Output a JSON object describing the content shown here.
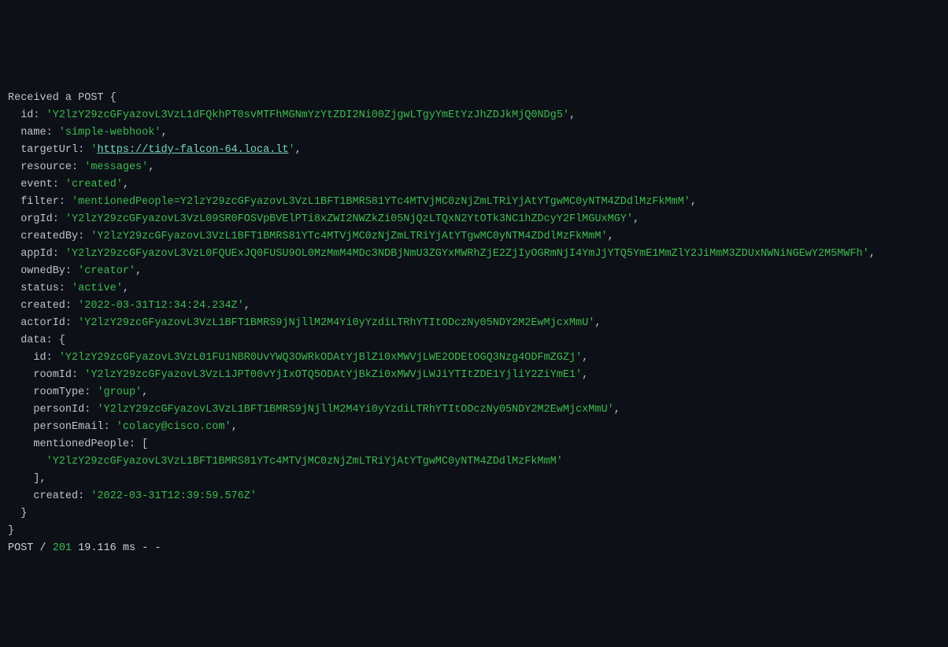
{
  "log": {
    "header": "Received a POST {",
    "id_key": "id:",
    "id_val": "'Y2lzY29zcGFyazovL3VzL1dFQkhPT0svMTFhMGNmYzYtZDI2Ni00ZjgwLTgyYmEtYzJhZDJkMjQ0NDg5'",
    "name_key": "name:",
    "name_val": "'simple-webhook'",
    "targetUrl_key": "targetUrl:",
    "targetUrl_q1": "'",
    "targetUrl_link": "https://tidy-falcon-64.loca.lt",
    "targetUrl_q2": "'",
    "resource_key": "resource:",
    "resource_val": "'messages'",
    "event_key": "event:",
    "event_val": "'created'",
    "filter_key": "filter:",
    "filter_val": "'mentionedPeople=Y2lzY29zcGFyazovL3VzL1BFT1BMRS81YTc4MTVjMC0zNjZmLTRiYjAtYTgwMC0yNTM4ZDdlMzFkMmM'",
    "orgId_key": "orgId:",
    "orgId_val": "'Y2lzY29zcGFyazovL3VzL09SR0FOSVpBVElPTi8xZWI2NWZkZi05NjQzLTQxN2YtOTk3NC1hZDcyY2FlMGUxMGY'",
    "createdBy_key": "createdBy:",
    "createdBy_val": "'Y2lzY29zcGFyazovL3VzL1BFT1BMRS81YTc4MTVjMC0zNjZmLTRiYjAtYTgwMC0yNTM4ZDdlMzFkMmM'",
    "appId_key": "appId:",
    "appId_val": "'Y2lzY29zcGFyazovL3VzL0FQUExJQ0FUSU9OL0MzMmM4MDc3NDBjNmU3ZGYxMWRhZjE2ZjIyOGRmNjI4YmJjYTQ5YmE1MmZlY2JiMmM3ZDUxNWNiNGEwY2M5MWFh'",
    "ownedBy_key": "ownedBy:",
    "ownedBy_val": "'creator'",
    "status_key": "status:",
    "status_val": "'active'",
    "created_key": "created:",
    "created_val": "'2022-03-31T12:34:24.234Z'",
    "actorId_key": "actorId:",
    "actorId_val": "'Y2lzY29zcGFyazovL3VzL1BFT1BMRS9jNjllM2M4Yi0yYzdiLTRhYTItODczNy05NDY2M2EwMjcxMmU'",
    "data_key": "data: {",
    "d_id_key": "id:",
    "d_id_val": "'Y2lzY29zcGFyazovL3VzL01FU1NBR0UvYWQ3OWRkODAtYjBlZi0xMWVjLWE2ODEtOGQ3Nzg4ODFmZGZj'",
    "d_roomId_key": "roomId:",
    "d_roomId_val": "'Y2lzY29zcGFyazovL3VzL1JPT00vYjIxOTQ5ODAtYjBkZi0xMWVjLWJiYTItZDE1YjliY2ZiYmE1'",
    "d_roomType_key": "roomType:",
    "d_roomType_val": "'group'",
    "d_personId_key": "personId:",
    "d_personId_val": "'Y2lzY29zcGFyazovL3VzL1BFT1BMRS9jNjllM2M4Yi0yYzdiLTRhYTItODczNy05NDY2M2EwMjcxMmU'",
    "d_personEmail_key": "personEmail:",
    "d_personEmail_val": "'colacy@cisco.com'",
    "d_mentionedPeople_key": "mentionedPeople: [",
    "d_mentionedPeople_item": "'Y2lzY29zcGFyazovL3VzL1BFT1BMRS81YTc4MTVjMC0zNjZmLTRiYjAtYTgwMC0yNTM4ZDdlMzFkMmM'",
    "d_mentionedPeople_close": "],",
    "d_created_key": "created:",
    "d_created_val": "'2022-03-31T12:39:59.576Z'",
    "data_close": "}",
    "obj_close": "}",
    "httpline_method": "POST / ",
    "httpline_status": "201",
    "httpline_rest": " 19.116 ms - -"
  }
}
